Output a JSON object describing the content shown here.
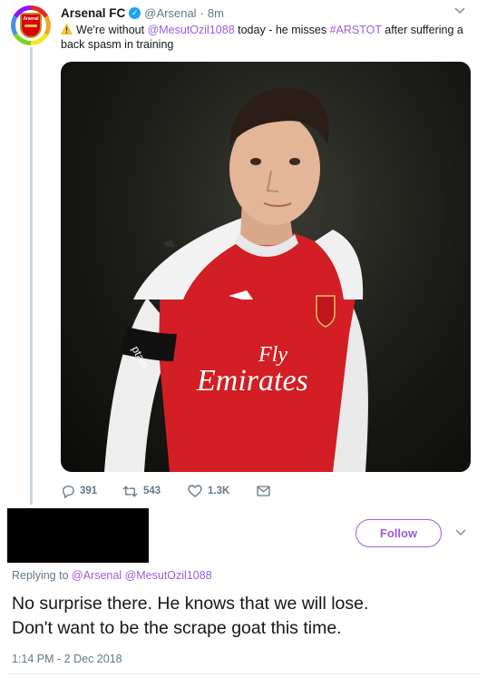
{
  "tweet": {
    "display_name": "Arsenal FC",
    "handle": "@Arsenal",
    "separator": "·",
    "time": "8m",
    "avatar_crest_text": "Arsenal",
    "text_before_mention": "We're without ",
    "mention": "@MesutOzil1088",
    "text_middle": " today - he misses ",
    "hashtag": "#ARSTOT",
    "text_after": " after suffering a back spasm in training",
    "photo": {
      "sponsor_line1": "Fly",
      "sponsor_line2": "Emirates",
      "armband_text": "ptain"
    },
    "actions": {
      "replies": "391",
      "retweets": "543",
      "likes": "1.3K"
    }
  },
  "reply": {
    "follow_label": "Follow",
    "replying_prefix": "Replying to ",
    "replying_to_1": "@Arsenal",
    "replying_to_2": "@MesutOzil1088",
    "text_line1": "No surprise there. He knows that we will lose.",
    "text_line2": "Don't want to be the scrape goat this time.",
    "timestamp": "1:14 PM - 2 Dec 2018"
  },
  "colors": {
    "link": "#9b5ddb",
    "verified": "#1da1f2",
    "muted": "#657786",
    "redaction": "#000000"
  }
}
